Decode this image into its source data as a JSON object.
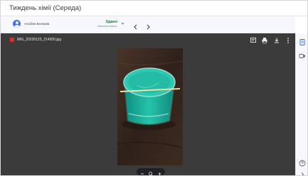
{
  "title": "Тиждень хімії (Середа)",
  "header": {
    "sender_name": "Альбіна Волкова",
    "status_main": "Здано",
    "status_sub": "Виконано вчасно",
    "prev_label": "‹",
    "next_label": "›"
  },
  "viewer": {
    "file_name": "IMG_20230125_214500.jpg",
    "file_type": "image"
  },
  "icons": {
    "file": "image-file-icon",
    "comment": "comment-icon",
    "print": "print-icon",
    "download": "download-icon",
    "more": "more-vertical-icon",
    "zoom_out": "zoom-out-icon",
    "zoom_reset": "zoom-icon",
    "zoom_in": "zoom-in-icon",
    "details": "details-icon",
    "video": "video-icon",
    "help": "help-icon",
    "expand": "chevron-right-icon"
  },
  "colors": {
    "viewer_bg": "#3b3b3b",
    "header_bg": "#f6f8fc",
    "status_green": "#188038",
    "accent_blue": "#1a73e8",
    "file_icon_red": "#d93025",
    "liquid": "#19b09a"
  }
}
